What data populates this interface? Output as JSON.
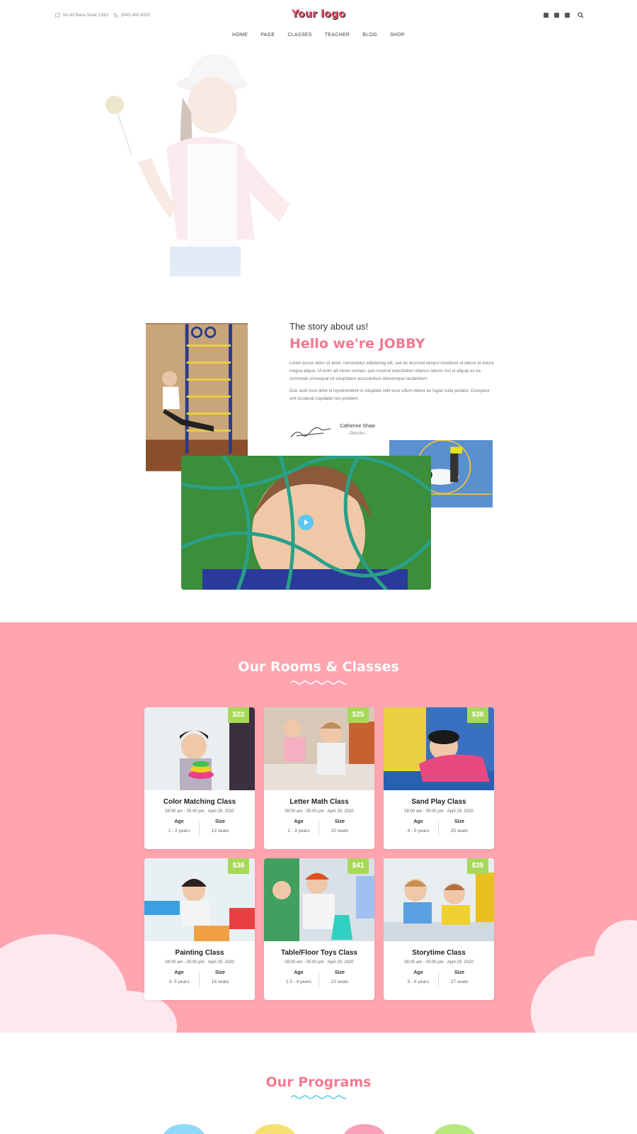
{
  "header": {
    "address": "No 40 Baria Sreet 133/2",
    "phone": "(840) 490 4283",
    "logo": "Your logo",
    "nav": [
      "HOME",
      "PAGE",
      "CLASSES",
      "TEACHER",
      "BLOG",
      "SHOP"
    ]
  },
  "about": {
    "subtitle": "The story about us!",
    "title": "Hello we're JOBBY",
    "paragraph1": "Lorem ipsum dolor sit amet, consectetur adipisicing elit, sed do eiusmod tempor incididunt ut labore et dolore magna aliqua. Ut enim ad minim veniam, quis nostrud exercitation ullamco laboris nisi ut aliquip ex ea commodo consequat sit volupfatem accusantium doloremque laudantium.",
    "paragraph2": "Duis aute irure dolor in reprehenderit in voluptate velit esse cillum dolore eu fugiat nulla pariatur. Excepteur sint occaecat cupidatat non proident.",
    "director_name": "Catherine Shaw",
    "director_role": "- Director -"
  },
  "rooms": {
    "title": "Our Rooms & Classes",
    "cards": [
      {
        "price": "$22",
        "name": "Color Matching Class",
        "time": "08:00 am - 05:00 pm",
        "date": "April 29, 2020",
        "age_label": "Age",
        "age": "1 - 2 years",
        "size_label": "Size",
        "size": "12 seats"
      },
      {
        "price": "$25",
        "name": "Letter Math Class",
        "time": "08:00 am - 05:00 pm",
        "date": "April 29, 2020",
        "age_label": "Age",
        "age": "2 - 3 years",
        "size_label": "Size",
        "size": "20 seats"
      },
      {
        "price": "$38",
        "name": "Sand Play Class",
        "time": "08:00 am - 05:00 pm",
        "date": "April 29, 2020",
        "age_label": "Age",
        "age": "4 - 5 years",
        "size_label": "Size",
        "size": "25 seats"
      },
      {
        "price": "$36",
        "name": "Painting Class",
        "time": "08:00 am - 05:00 pm",
        "date": "April 29, 2020",
        "age_label": "Age",
        "age": "3- 5 years",
        "size_label": "Size",
        "size": "18 seats"
      },
      {
        "price": "$41",
        "name": "Table/Floor Toys Class",
        "time": "08:00 am - 05:00 pm",
        "date": "April 29, 2020",
        "age_label": "Age",
        "age": "2.5 - 4 years",
        "size_label": "Size",
        "size": "22 seats"
      },
      {
        "price": "$35",
        "name": "Storytime Class",
        "time": "08:00 am - 05:00 pm",
        "date": "April 29, 2020",
        "age_label": "Age",
        "age": "5 - 6 years",
        "size_label": "Size",
        "size": "27 seats"
      }
    ]
  },
  "programs": {
    "title": "Our Programs"
  },
  "colors": {
    "accent_pink": "#f07a91",
    "rooms_bg": "#ffa5b0",
    "price_green": "#a8d85a",
    "wave_blue": "#5ac8f0"
  },
  "icons": [
    "map-icon",
    "phone-icon",
    "facebook-icon",
    "twitter-icon",
    "instagram-icon",
    "search-icon",
    "play-icon"
  ]
}
